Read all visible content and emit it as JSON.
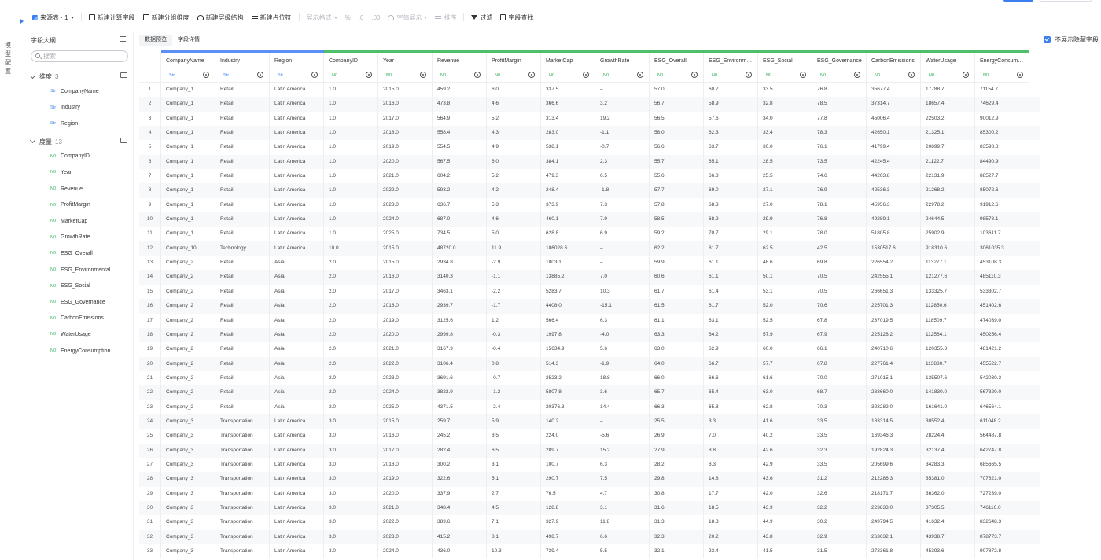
{
  "rail": {
    "label": "模型配置"
  },
  "toolbar": {
    "source": "来源表 · 1",
    "items": [
      {
        "label": "新建计算字段",
        "icon": "calc-field-icon",
        "disabled": false
      },
      {
        "label": "新建分组维度",
        "icon": "group-dimension-icon",
        "disabled": false
      },
      {
        "label": "新建层级结构",
        "icon": "hierarchy-icon",
        "disabled": false
      },
      {
        "label": "新建占位符",
        "icon": "placeholder-icon",
        "disabled": false
      },
      {
        "label": "展示格式",
        "icon": "",
        "disabled": true
      },
      {
        "label": "%",
        "icon": "",
        "disabled": true
      },
      {
        "label": ".0",
        "icon": "",
        "disabled": true
      },
      {
        "label": ".00",
        "icon": "",
        "disabled": true
      },
      {
        "label": "空值展示",
        "icon": "null-display-icon",
        "disabled": true
      },
      {
        "label": "排序",
        "icon": "sort-icon",
        "disabled": true
      },
      {
        "label": "过滤",
        "icon": "filter-icon",
        "disabled": false
      },
      {
        "label": "字段查找",
        "icon": "field-search-icon",
        "disabled": false
      }
    ]
  },
  "left": {
    "title": "字段大纲",
    "search_placeholder": "搜索",
    "dimensions": {
      "label": "维度",
      "count": "3",
      "fields": [
        "CompanyName",
        "Industry",
        "Region"
      ]
    },
    "measures": {
      "label": "度量",
      "count": "13",
      "fields": [
        "CompanyID",
        "Year",
        "Revenue",
        "ProfitMargin",
        "MarketCap",
        "GrowthRate",
        "ESG_Overall",
        "ESG_Environmental",
        "ESG_Social",
        "ESG_Governance",
        "CarbonEmissions",
        "WaterUsage",
        "EnergyConsumption"
      ]
    },
    "type_str": "Str",
    "type_num": "N0"
  },
  "main": {
    "tabs": [
      "数据预览",
      "字段详情"
    ],
    "hide_fields_label": "不展示隐藏字段",
    "columns": [
      {
        "name": "CompanyName",
        "type": "Str"
      },
      {
        "name": "Industry",
        "type": "Str"
      },
      {
        "name": "Region",
        "type": "Str"
      },
      {
        "name": "CompanyID",
        "type": "N0"
      },
      {
        "name": "Year",
        "type": "N0"
      },
      {
        "name": "Revenue",
        "type": "N0"
      },
      {
        "name": "ProfitMargin",
        "type": "N0"
      },
      {
        "name": "MarketCap",
        "type": "N0"
      },
      {
        "name": "GrowthRate",
        "type": "N0"
      },
      {
        "name": "ESG_Overall",
        "type": "N0"
      },
      {
        "name": "ESG_Environmental",
        "type": "N0"
      },
      {
        "name": "ESG_Social",
        "type": "N0"
      },
      {
        "name": "ESG_Governance",
        "type": "N0"
      },
      {
        "name": "CarbonEmissions",
        "type": "N0"
      },
      {
        "name": "WaterUsage",
        "type": "N0"
      },
      {
        "name": "EnergyConsumption",
        "type": "N0"
      }
    ],
    "rows": [
      [
        "1",
        "Company_1",
        "Retail",
        "Latin America",
        "1.0",
        "2015.0",
        "459.2",
        "6.0",
        "337.5",
        "–",
        "57.0",
        "60.7",
        "33.5",
        "76.8",
        "35677.4",
        "17788.7",
        "71154.7"
      ],
      [
        "2",
        "Company_1",
        "Retail",
        "Latin America",
        "1.0",
        "2016.0",
        "473.8",
        "4.6",
        "366.6",
        "3.2",
        "56.7",
        "58.9",
        "32.8",
        "78.5",
        "37314.7",
        "18657.4",
        "74629.4"
      ],
      [
        "3",
        "Company_1",
        "Retail",
        "Latin America",
        "1.0",
        "2017.0",
        "564.9",
        "5.2",
        "313.4",
        "19.2",
        "56.5",
        "57.6",
        "34.0",
        "77.8",
        "45006.4",
        "22503.2",
        "90012.9"
      ],
      [
        "4",
        "Company_1",
        "Retail",
        "Latin America",
        "1.0",
        "2018.0",
        "558.4",
        "4.3",
        "283.0",
        "-1.1",
        "58.0",
        "62.3",
        "33.4",
        "78.3",
        "42650.1",
        "21325.1",
        "85300.2"
      ],
      [
        "5",
        "Company_1",
        "Retail",
        "Latin America",
        "1.0",
        "2019.0",
        "554.5",
        "4.9",
        "538.1",
        "-0.7",
        "56.6",
        "63.7",
        "30.0",
        "76.1",
        "41799.4",
        "20899.7",
        "83598.8"
      ],
      [
        "6",
        "Company_1",
        "Retail",
        "Latin America",
        "1.0",
        "2020.0",
        "567.5",
        "6.0",
        "384.1",
        "2.3",
        "55.7",
        "65.1",
        "28.5",
        "73.5",
        "42245.4",
        "21122.7",
        "84490.9"
      ],
      [
        "7",
        "Company_1",
        "Retail",
        "Latin America",
        "1.0",
        "2021.0",
        "604.2",
        "5.2",
        "479.3",
        "6.5",
        "55.6",
        "66.8",
        "25.5",
        "74.6",
        "44263.8",
        "22131.9",
        "88527.7"
      ],
      [
        "8",
        "Company_1",
        "Retail",
        "Latin America",
        "1.0",
        "2022.0",
        "593.2",
        "4.2",
        "248.4",
        "-1.8",
        "57.7",
        "69.0",
        "27.1",
        "76.9",
        "42536.3",
        "21268.2",
        "85072.6"
      ],
      [
        "9",
        "Company_1",
        "Retail",
        "Latin America",
        "1.0",
        "2023.0",
        "636.7",
        "5.3",
        "373.9",
        "7.3",
        "57.8",
        "68.3",
        "27.0",
        "78.1",
        "45956.3",
        "22978.2",
        "91912.6"
      ],
      [
        "10",
        "Company_1",
        "Retail",
        "Latin America",
        "1.0",
        "2024.0",
        "687.0",
        "4.6",
        "460.1",
        "7.9",
        "58.5",
        "68.9",
        "29.9",
        "76.8",
        "49289.1",
        "24644.5",
        "98578.1"
      ],
      [
        "11",
        "Company_1",
        "Retail",
        "Latin America",
        "1.0",
        "2025.0",
        "734.5",
        "5.0",
        "628.8",
        "6.9",
        "59.2",
        "70.7",
        "29.1",
        "78.0",
        "51805.8",
        "25902.9",
        "103611.7"
      ],
      [
        "12",
        "Company_10",
        "Technology",
        "Latin America",
        "10.0",
        "2015.0",
        "48720.0",
        "11.9",
        "186028.6",
        "–",
        "62.2",
        "81.7",
        "62.5",
        "42.5",
        "1530517.6",
        "918310.6",
        "3061035.3"
      ],
      [
        "13",
        "Company_2",
        "Retail",
        "Asia",
        "2.0",
        "2015.0",
        "2934.8",
        "-2.9",
        "1803.1",
        "–",
        "59.9",
        "61.1",
        "48.6",
        "69.8",
        "226554.2",
        "113277.1",
        "453108.3"
      ],
      [
        "14",
        "Company_2",
        "Retail",
        "Asia",
        "2.0",
        "2016.0",
        "3140.3",
        "-1.1",
        "13885.2",
        "7.0",
        "60.6",
        "61.1",
        "50.1",
        "70.5",
        "242555.1",
        "121277.6",
        "485110.3"
      ],
      [
        "15",
        "Company_2",
        "Retail",
        "Asia",
        "2.0",
        "2017.0",
        "3463.1",
        "-2.2",
        "5283.7",
        "10.3",
        "61.7",
        "61.4",
        "53.1",
        "70.5",
        "266651.3",
        "133325.7",
        "533302.7"
      ],
      [
        "16",
        "Company_2",
        "Retail",
        "Asia",
        "2.0",
        "2018.0",
        "2939.7",
        "-1.7",
        "4408.0",
        "-15.1",
        "61.5",
        "61.7",
        "52.0",
        "70.6",
        "225701.3",
        "112850.6",
        "451402.6"
      ],
      [
        "17",
        "Company_2",
        "Retail",
        "Asia",
        "2.0",
        "2019.0",
        "3125.6",
        "1.2",
        "566.4",
        "6.3",
        "61.1",
        "63.1",
        "52.5",
        "67.8",
        "237019.5",
        "118509.7",
        "474039.0"
      ],
      [
        "18",
        "Company_2",
        "Retail",
        "Asia",
        "2.0",
        "2020.0",
        "2999.8",
        "-0.3",
        "1997.8",
        "-4.0",
        "63.3",
        "64.2",
        "57.9",
        "67.9",
        "225128.2",
        "112564.1",
        "450256.4"
      ],
      [
        "19",
        "Company_2",
        "Retail",
        "Asia",
        "2.0",
        "2021.0",
        "3167.9",
        "-0.4",
        "15634.9",
        "5.6",
        "63.0",
        "62.9",
        "60.0",
        "66.1",
        "240710.6",
        "120355.3",
        "481421.2"
      ],
      [
        "20",
        "Company_2",
        "Retail",
        "Asia",
        "2.0",
        "2022.0",
        "3106.4",
        "0.8",
        "514.3",
        "-1.9",
        "64.0",
        "66.7",
        "57.7",
        "67.8",
        "227761.4",
        "113880.7",
        "455522.7"
      ],
      [
        "21",
        "Company_2",
        "Retail",
        "Asia",
        "2.0",
        "2023.0",
        "3691.6",
        "-0.7",
        "2523.2",
        "18.8",
        "66.0",
        "66.6",
        "61.6",
        "70.0",
        "271015.1",
        "135507.6",
        "542030.3"
      ],
      [
        "22",
        "Company_2",
        "Retail",
        "Asia",
        "2.0",
        "2024.0",
        "3822.9",
        "-1.2",
        "5807.8",
        "3.6",
        "65.7",
        "65.4",
        "63.0",
        "68.7",
        "283660.0",
        "141830.0",
        "567320.0"
      ],
      [
        "23",
        "Company_2",
        "Retail",
        "Asia",
        "2.0",
        "2025.0",
        "4371.5",
        "-2.4",
        "20376.3",
        "14.4",
        "66.3",
        "65.8",
        "62.8",
        "70.3",
        "323282.0",
        "161641.0",
        "646564.1"
      ],
      [
        "24",
        "Company_3",
        "Transportation",
        "Latin America",
        "3.0",
        "2015.0",
        "259.7",
        "5.9",
        "140.2",
        "–",
        "25.5",
        "3.3",
        "41.6",
        "33.5",
        "183314.5",
        "30552.4",
        "611048.2"
      ],
      [
        "25",
        "Company_3",
        "Transportation",
        "Latin America",
        "3.0",
        "2016.0",
        "245.2",
        "8.5",
        "224.0",
        "-5.6",
        "26.9",
        "7.0",
        "40.2",
        "33.5",
        "169346.3",
        "28224.4",
        "564487.8"
      ],
      [
        "26",
        "Company_3",
        "Transportation",
        "Latin America",
        "3.0",
        "2017.0",
        "282.4",
        "6.5",
        "289.7",
        "15.2",
        "27.9",
        "8.8",
        "42.6",
        "32.3",
        "192824.3",
        "32137.4",
        "642747.8"
      ],
      [
        "27",
        "Company_3",
        "Transportation",
        "Latin America",
        "3.0",
        "2018.0",
        "300.2",
        "3.1",
        "100.7",
        "6.3",
        "28.2",
        "8.3",
        "42.9",
        "33.5",
        "205699.6",
        "34283.3",
        "685665.5"
      ],
      [
        "28",
        "Company_3",
        "Transportation",
        "Latin America",
        "3.0",
        "2019.0",
        "322.6",
        "5.1",
        "290.7",
        "7.5",
        "29.8",
        "14.8",
        "43.6",
        "31.2",
        "212286.3",
        "35381.0",
        "707621.0"
      ],
      [
        "29",
        "Company_3",
        "Transportation",
        "Latin America",
        "3.0",
        "2020.0",
        "337.9",
        "2.7",
        "76.5",
        "4.7",
        "30.8",
        "17.7",
        "42.0",
        "32.6",
        "218171.7",
        "36362.0",
        "727239.0"
      ],
      [
        "30",
        "Company_3",
        "Transportation",
        "Latin America",
        "3.0",
        "2021.0",
        "348.4",
        "4.5",
        "128.8",
        "3.1",
        "31.6",
        "18.5",
        "43.9",
        "32.2",
        "223833.0",
        "37305.5",
        "746110.0"
      ],
      [
        "31",
        "Company_3",
        "Transportation",
        "Latin America",
        "3.0",
        "2022.0",
        "389.6",
        "7.1",
        "327.9",
        "11.8",
        "31.3",
        "18.8",
        "44.9",
        "30.2",
        "249794.5",
        "41632.4",
        "832648.3"
      ],
      [
        "32",
        "Company_3",
        "Transportation",
        "Latin America",
        "3.0",
        "2023.0",
        "415.2",
        "8.1",
        "498.7",
        "6.6",
        "32.3",
        "20.2",
        "43.8",
        "32.9",
        "263632.1",
        "43938.7",
        "878773.7"
      ],
      [
        "33",
        "Company_3",
        "Transportation",
        "Latin America",
        "3.0",
        "2024.0",
        "436.0",
        "10.3",
        "739.4",
        "5.5",
        "32.1",
        "23.4",
        "41.5",
        "31.5",
        "272361.8",
        "45393.6",
        "907872.8"
      ]
    ]
  },
  "colors": {
    "accent": "#3d7ff0",
    "measure": "#2fae54",
    "dim_bar": "#5b8ff5",
    "measure_bar": "#4cc16a"
  }
}
